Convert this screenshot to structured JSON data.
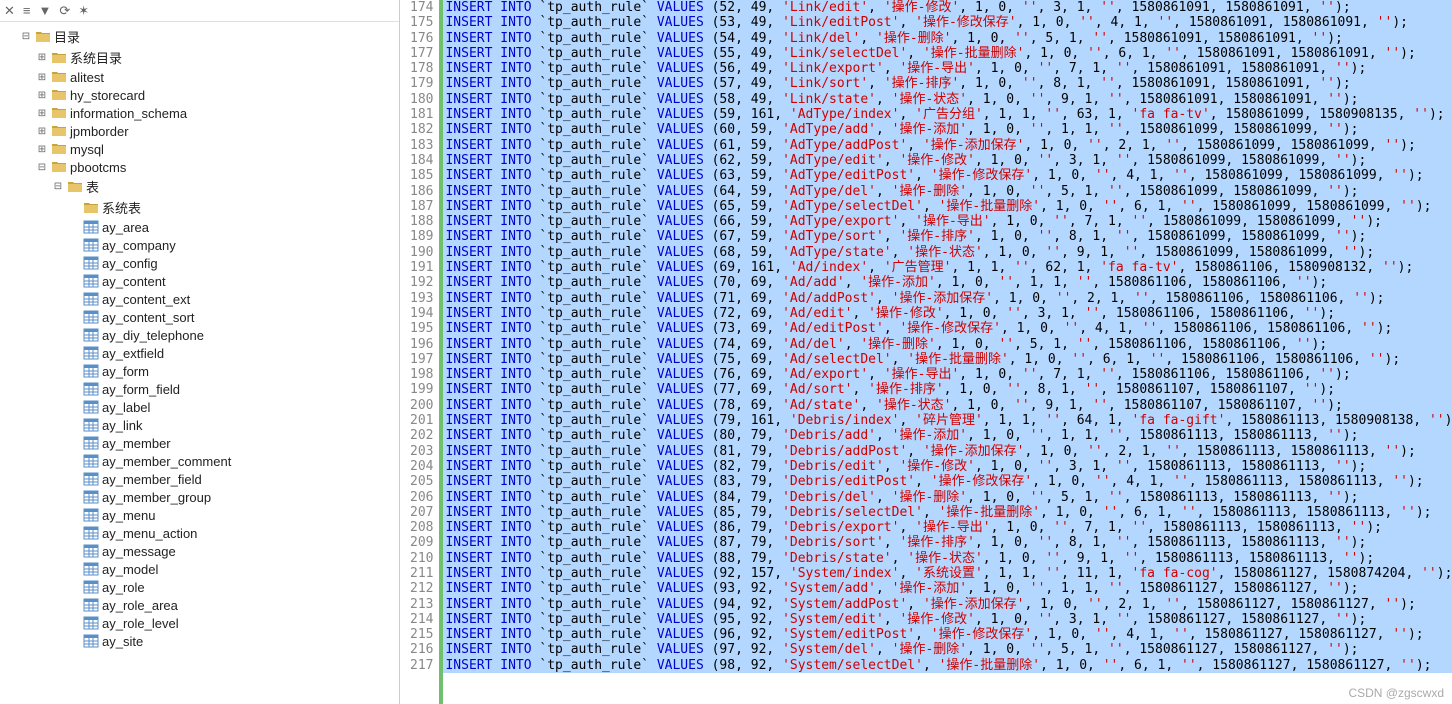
{
  "toolbar_icons": [
    "filter-icon",
    "sort-icon",
    "funnel-icon",
    "refresh-icon",
    "activity-icon"
  ],
  "root_label": "目录",
  "databases": [
    {
      "name": "系统目录",
      "expanded": false
    },
    {
      "name": "alitest",
      "expanded": false
    },
    {
      "name": "hy_storecard",
      "expanded": false
    },
    {
      "name": "information_schema",
      "expanded": false
    },
    {
      "name": "jpmborder",
      "expanded": false
    },
    {
      "name": "mysql",
      "expanded": false
    },
    {
      "name": "pbootcms",
      "expanded": true
    }
  ],
  "tables_node_label": "表",
  "sys_tables_label": "系统表",
  "tables": [
    "ay_area",
    "ay_company",
    "ay_config",
    "ay_content",
    "ay_content_ext",
    "ay_content_sort",
    "ay_diy_telephone",
    "ay_extfield",
    "ay_form",
    "ay_form_field",
    "ay_label",
    "ay_link",
    "ay_member",
    "ay_member_comment",
    "ay_member_field",
    "ay_member_group",
    "ay_menu",
    "ay_menu_action",
    "ay_message",
    "ay_model",
    "ay_role",
    "ay_role_area",
    "ay_role_level",
    "ay_site"
  ],
  "sql_prefix": {
    "insert": "INSERT INTO",
    "values": "VALUES",
    "table": "`tp_auth_rule`"
  },
  "sql_rows": [
    {
      "ln": 174,
      "v": "(52, 49, 'Link/edit', '操作-修改', 1, 0, '', 3, 1, '', 1580861091, 1580861091, '');"
    },
    {
      "ln": 175,
      "v": "(53, 49, 'Link/editPost', '操作-修改保存', 1, 0, '', 4, 1, '', 1580861091, 1580861091, '');"
    },
    {
      "ln": 176,
      "v": "(54, 49, 'Link/del', '操作-删除', 1, 0, '', 5, 1, '', 1580861091, 1580861091, '');"
    },
    {
      "ln": 177,
      "v": "(55, 49, 'Link/selectDel', '操作-批量删除', 1, 0, '', 6, 1, '', 1580861091, 1580861091, '');"
    },
    {
      "ln": 178,
      "v": "(56, 49, 'Link/export', '操作-导出', 1, 0, '', 7, 1, '', 1580861091, 1580861091, '');"
    },
    {
      "ln": 179,
      "v": "(57, 49, 'Link/sort', '操作-排序', 1, 0, '', 8, 1, '', 1580861091, 1580861091, '');"
    },
    {
      "ln": 180,
      "v": "(58, 49, 'Link/state', '操作-状态', 1, 0, '', 9, 1, '', 1580861091, 1580861091, '');"
    },
    {
      "ln": 181,
      "v": "(59, 161, 'AdType/index', '广告分组', 1, 1, '', 63, 1, 'fa fa-tv', 1580861099, 1580908135, '');"
    },
    {
      "ln": 182,
      "v": "(60, 59, 'AdType/add', '操作-添加', 1, 0, '', 1, 1, '', 1580861099, 1580861099, '');"
    },
    {
      "ln": 183,
      "v": "(61, 59, 'AdType/addPost', '操作-添加保存', 1, 0, '', 2, 1, '', 1580861099, 1580861099, '');"
    },
    {
      "ln": 184,
      "v": "(62, 59, 'AdType/edit', '操作-修改', 1, 0, '', 3, 1, '', 1580861099, 1580861099, '');"
    },
    {
      "ln": 185,
      "v": "(63, 59, 'AdType/editPost', '操作-修改保存', 1, 0, '', 4, 1, '', 1580861099, 1580861099, '');"
    },
    {
      "ln": 186,
      "v": "(64, 59, 'AdType/del', '操作-删除', 1, 0, '', 5, 1, '', 1580861099, 1580861099, '');"
    },
    {
      "ln": 187,
      "v": "(65, 59, 'AdType/selectDel', '操作-批量删除', 1, 0, '', 6, 1, '', 1580861099, 1580861099, '');"
    },
    {
      "ln": 188,
      "v": "(66, 59, 'AdType/export', '操作-导出', 1, 0, '', 7, 1, '', 1580861099, 1580861099, '');"
    },
    {
      "ln": 189,
      "v": "(67, 59, 'AdType/sort', '操作-排序', 1, 0, '', 8, 1, '', 1580861099, 1580861099, '');"
    },
    {
      "ln": 190,
      "v": "(68, 59, 'AdType/state', '操作-状态', 1, 0, '', 9, 1, '', 1580861099, 1580861099, '');"
    },
    {
      "ln": 191,
      "v": "(69, 161, 'Ad/index', '广告管理', 1, 1, '', 62, 1, 'fa fa-tv', 1580861106, 1580908132, '');"
    },
    {
      "ln": 192,
      "v": "(70, 69, 'Ad/add', '操作-添加', 1, 0, '', 1, 1, '', 1580861106, 1580861106, '');"
    },
    {
      "ln": 193,
      "v": "(71, 69, 'Ad/addPost', '操作-添加保存', 1, 0, '', 2, 1, '', 1580861106, 1580861106, '');"
    },
    {
      "ln": 194,
      "v": "(72, 69, 'Ad/edit', '操作-修改', 1, 0, '', 3, 1, '', 1580861106, 1580861106, '');"
    },
    {
      "ln": 195,
      "v": "(73, 69, 'Ad/editPost', '操作-修改保存', 1, 0, '', 4, 1, '', 1580861106, 1580861106, '');"
    },
    {
      "ln": 196,
      "v": "(74, 69, 'Ad/del', '操作-删除', 1, 0, '', 5, 1, '', 1580861106, 1580861106, '');"
    },
    {
      "ln": 197,
      "v": "(75, 69, 'Ad/selectDel', '操作-批量删除', 1, 0, '', 6, 1, '', 1580861106, 1580861106, '');"
    },
    {
      "ln": 198,
      "v": "(76, 69, 'Ad/export', '操作-导出', 1, 0, '', 7, 1, '', 1580861106, 1580861106, '');"
    },
    {
      "ln": 199,
      "v": "(77, 69, 'Ad/sort', '操作-排序', 1, 0, '', 8, 1, '', 1580861107, 1580861107, '');"
    },
    {
      "ln": 200,
      "v": "(78, 69, 'Ad/state', '操作-状态', 1, 0, '', 9, 1, '', 1580861107, 1580861107, '');"
    },
    {
      "ln": 201,
      "v": "(79, 161, 'Debris/index', '碎片管理', 1, 1, '', 64, 1, 'fa fa-gift', 1580861113, 1580908138, '');"
    },
    {
      "ln": 202,
      "v": "(80, 79, 'Debris/add', '操作-添加', 1, 0, '', 1, 1, '', 1580861113, 1580861113, '');"
    },
    {
      "ln": 203,
      "v": "(81, 79, 'Debris/addPost', '操作-添加保存', 1, 0, '', 2, 1, '', 1580861113, 1580861113, '');"
    },
    {
      "ln": 204,
      "v": "(82, 79, 'Debris/edit', '操作-修改', 1, 0, '', 3, 1, '', 1580861113, 1580861113, '');"
    },
    {
      "ln": 205,
      "v": "(83, 79, 'Debris/editPost', '操作-修改保存', 1, 0, '', 4, 1, '', 1580861113, 1580861113, '');"
    },
    {
      "ln": 206,
      "v": "(84, 79, 'Debris/del', '操作-删除', 1, 0, '', 5, 1, '', 1580861113, 1580861113, '');"
    },
    {
      "ln": 207,
      "v": "(85, 79, 'Debris/selectDel', '操作-批量删除', 1, 0, '', 6, 1, '', 1580861113, 1580861113, '');"
    },
    {
      "ln": 208,
      "v": "(86, 79, 'Debris/export', '操作-导出', 1, 0, '', 7, 1, '', 1580861113, 1580861113, '');"
    },
    {
      "ln": 209,
      "v": "(87, 79, 'Debris/sort', '操作-排序', 1, 0, '', 8, 1, '', 1580861113, 1580861113, '');"
    },
    {
      "ln": 210,
      "v": "(88, 79, 'Debris/state', '操作-状态', 1, 0, '', 9, 1, '', 1580861113, 1580861113, '');"
    },
    {
      "ln": 211,
      "v": "(92, 157, 'System/index', '系统设置', 1, 1, '', 11, 1, 'fa fa-cog', 1580861127, 1580874204, '');"
    },
    {
      "ln": 212,
      "v": "(93, 92, 'System/add', '操作-添加', 1, 0, '', 1, 1, '', 1580861127, 1580861127, '');"
    },
    {
      "ln": 213,
      "v": "(94, 92, 'System/addPost', '操作-添加保存', 1, 0, '', 2, 1, '', 1580861127, 1580861127, '');"
    },
    {
      "ln": 214,
      "v": "(95, 92, 'System/edit', '操作-修改', 1, 0, '', 3, 1, '', 1580861127, 1580861127, '');"
    },
    {
      "ln": 215,
      "v": "(96, 92, 'System/editPost', '操作-修改保存', 1, 0, '', 4, 1, '', 1580861127, 1580861127, '');"
    },
    {
      "ln": 216,
      "v": "(97, 92, 'System/del', '操作-删除', 1, 0, '', 5, 1, '', 1580861127, 1580861127, '');"
    },
    {
      "ln": 217,
      "v": "(98, 92, 'System/selectDel', '操作-批量删除', 1, 0, '', 6, 1, '', 1580861127, 1580861127, '');"
    }
  ],
  "watermark": "CSDN @zgscwxd"
}
